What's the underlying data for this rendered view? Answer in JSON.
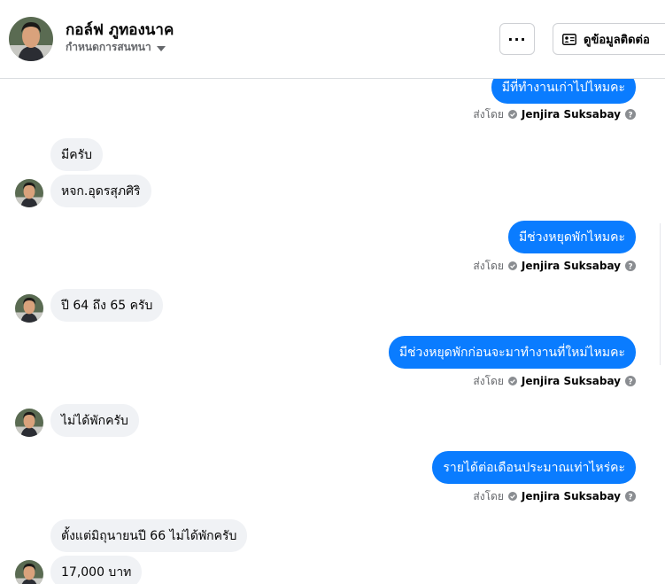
{
  "header": {
    "name": "กอล์ฟ ภูทองนาค",
    "subtitle": "กำหนดการสนทนา",
    "more_label": "···",
    "contact_label": "ดูข้อมูลติดต่อ"
  },
  "sent_by_label": "ส่งโดย",
  "sender_name": "Jenjira Suksabay",
  "messages": {
    "m1": "มีที่ทำงานเก่าไปไหมคะ",
    "m2": "มีครับ",
    "m3": "หจก.อุดรสุภศิริ",
    "m4": "มีช่วงหยุดพักไหมคะ",
    "m5": "ปี 64 ถึง 65 ครับ",
    "m6": "มีช่วงหยุดพักก่อนจะมาทำงานที่ใหม่ไหมคะ",
    "m7": "ไม่ได้พักครับ",
    "m8": "รายได้ต่อเดือนประมาณเท่าไหร่คะ",
    "m9": "ตั้งแต่มิถุนายนปี 66 ไม่ได้พักครับ",
    "m10": "17,000 บาท"
  },
  "colors": {
    "outgoing_bubble": "#0a7cff",
    "incoming_bubble": "#f0f2f5"
  }
}
